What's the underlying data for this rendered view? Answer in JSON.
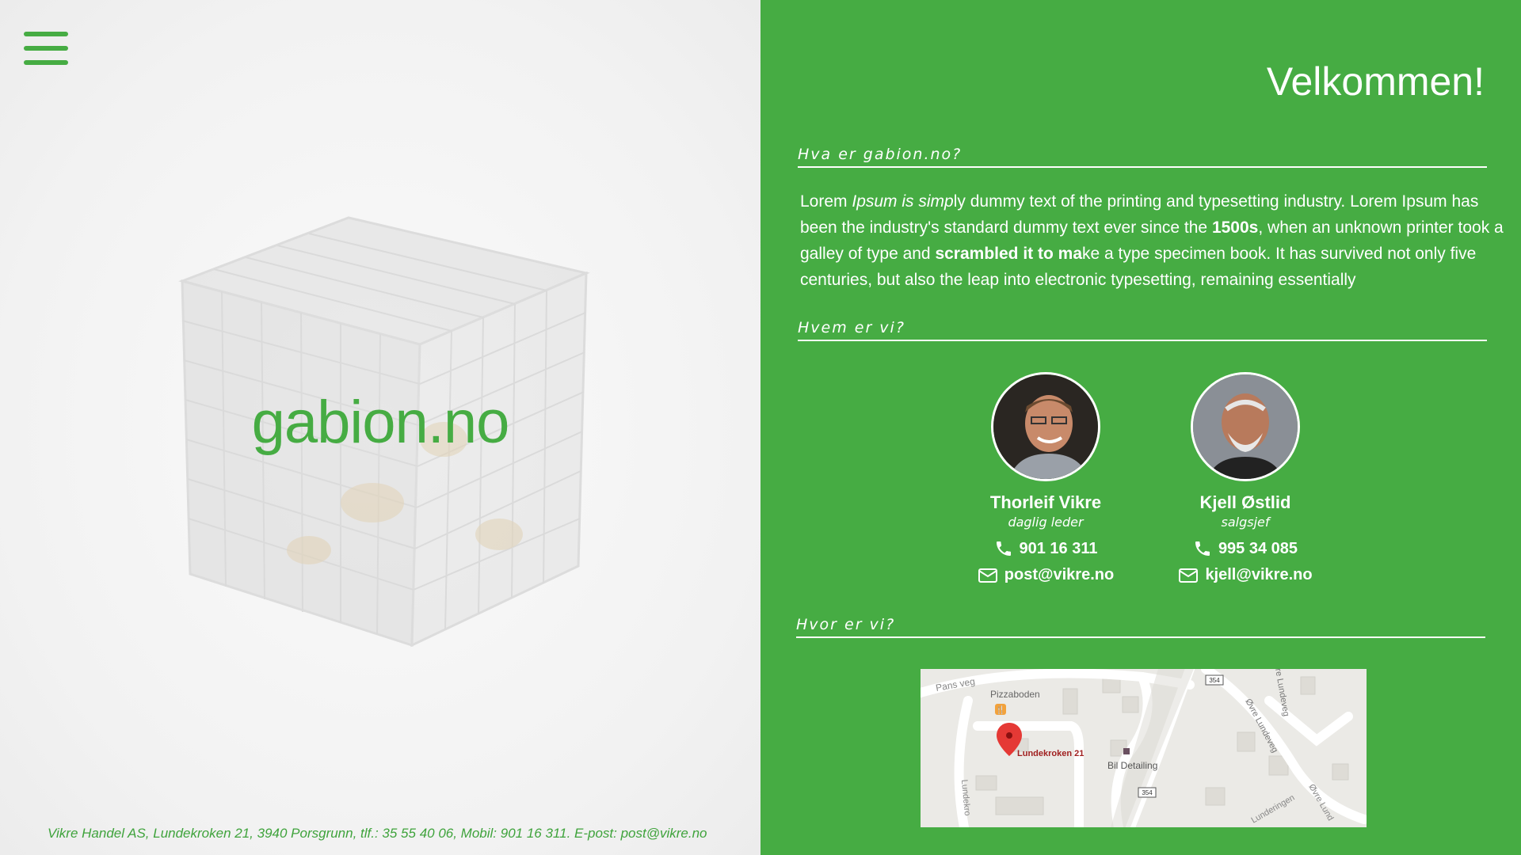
{
  "header": {
    "menu_icon": "hamburger-icon"
  },
  "brand": {
    "logo_text": "gabion.no",
    "accent": "#46ac43"
  },
  "footer": {
    "text": "Vikre Handel AS, Lundekroken 21, 3940 Porsgrunn, tlf.: 35 55 40 06, Mobil: 901 16 311. E-post: post@vikre.no"
  },
  "main": {
    "title": "Velkommen!",
    "sections": {
      "about": "Hva er gabion.no?",
      "who": "Hvem er vi?",
      "where": "Hvor er vi?"
    },
    "intro": {
      "p1": "Lorem ",
      "p2": "Ipsum is simp",
      "p3": "ly dummy text of the printing and typesetting industry. Lorem Ipsum has been the industry's standard dummy text ever since the ",
      "p4": "1500s",
      "p5": ", when an unknown printer took a galley of type and ",
      "p6": "scrambled it to ma",
      "p7": "ke a type specimen book. It has survived not only five centuries, but also the leap into electronic typesetting, remaining essentially"
    },
    "people": [
      {
        "name": "Thorleif Vikre",
        "role": "daglig leder",
        "phone": "901 16 311",
        "email": "post@vikre.no"
      },
      {
        "name": "Kjell Østlid",
        "role": "salgsjef",
        "phone": "995 34 085",
        "email": "kjell@vikre.no"
      }
    ],
    "map": {
      "labels": {
        "road1": "Pans veg",
        "poi1": "Pizzaboden",
        "marker": "Lundekroken 21",
        "poi2": "Bil Detailing",
        "road2": "Øvre Lundeveg",
        "road3": "re Lundeveg",
        "road4": "Lundekro",
        "road5": "Lunderingen",
        "road6": "Øvre Lund",
        "shield1": "354",
        "shield2": "354"
      }
    }
  }
}
